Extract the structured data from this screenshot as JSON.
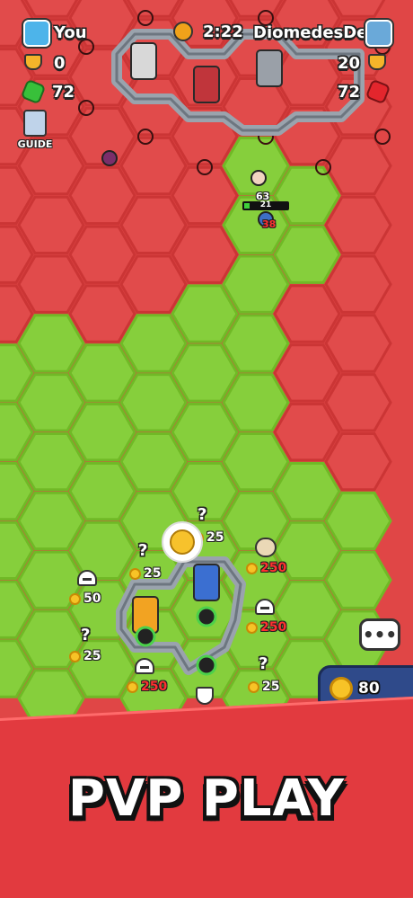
{
  "hud": {
    "player_name": "You",
    "opponent_name": "DiomedesDee",
    "timer": "2:22",
    "player_trophies": "0",
    "opponent_trophies": "20",
    "player_gems": "72",
    "opponent_gems": "72",
    "guide_label": "GUIDE"
  },
  "units": {
    "enemy_label": "63",
    "ally_hp": "21",
    "ally_level": "38"
  },
  "build_slots": [
    {
      "cost": "25"
    },
    {
      "cost": "25"
    },
    {
      "cost": "250"
    },
    {
      "cost": "50"
    },
    {
      "cost": "250"
    },
    {
      "cost": "25"
    },
    {
      "cost": "250"
    },
    {
      "cost": "25"
    }
  ],
  "coin_panel": {
    "amount": "80"
  },
  "chat_button": {
    "label": "•••"
  },
  "banner": {
    "title": "PVP PLAY"
  },
  "colors": {
    "enemy_territory": "#e14b4b",
    "player_territory": "#86cf3c",
    "wall": "#9aa3ad",
    "banner": "#e23a3f",
    "coin_panel": "#2f4a8a"
  }
}
